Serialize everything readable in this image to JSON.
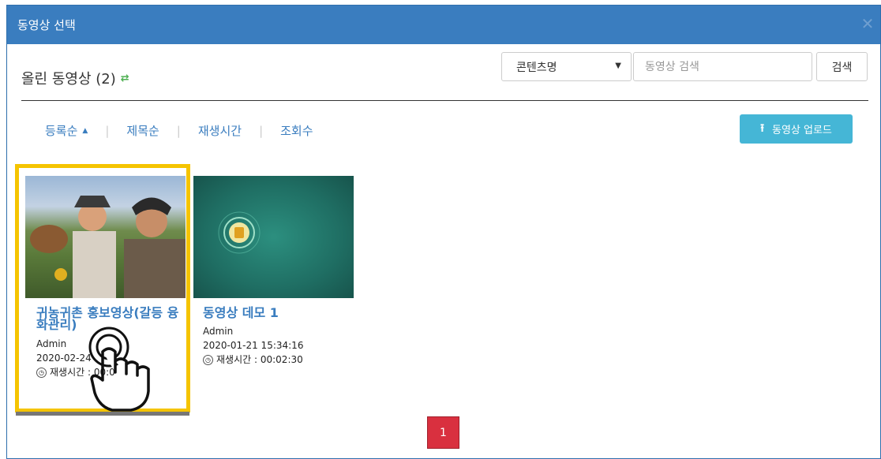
{
  "dialog": {
    "title": "동영상 선택",
    "close_icon": "close-icon"
  },
  "header": {
    "title": "올린 동영상 (2)",
    "refresh_icon": "refresh-icon",
    "filter_select": {
      "selected": "콘텐츠명",
      "options": [
        "콘텐츠명"
      ]
    },
    "search_placeholder": "동영상 검색",
    "search_button": "검색"
  },
  "sort": {
    "items": [
      "등록순",
      "제목순",
      "재생시간",
      "조회수"
    ],
    "active": "등록순"
  },
  "upload_button": "동영상 업로드",
  "videos": [
    {
      "title": "귀농귀촌 홍보영상(갈등 융화관리)",
      "author": "Admin",
      "date": "2020-02-24",
      "duration_label": "재생시간 :",
      "duration": "00:0"
    },
    {
      "title": "동영상 데모 1",
      "author": "Admin",
      "date": "2020-01-21 15:34:16",
      "duration_label": "재생시간 :",
      "duration": "00:02:30"
    }
  ],
  "pagination": {
    "current": "1"
  },
  "colors": {
    "primary": "#3a7dbf",
    "highlight": "#f5c400",
    "upload": "#45b6d6",
    "page_active": "#d9303f"
  }
}
